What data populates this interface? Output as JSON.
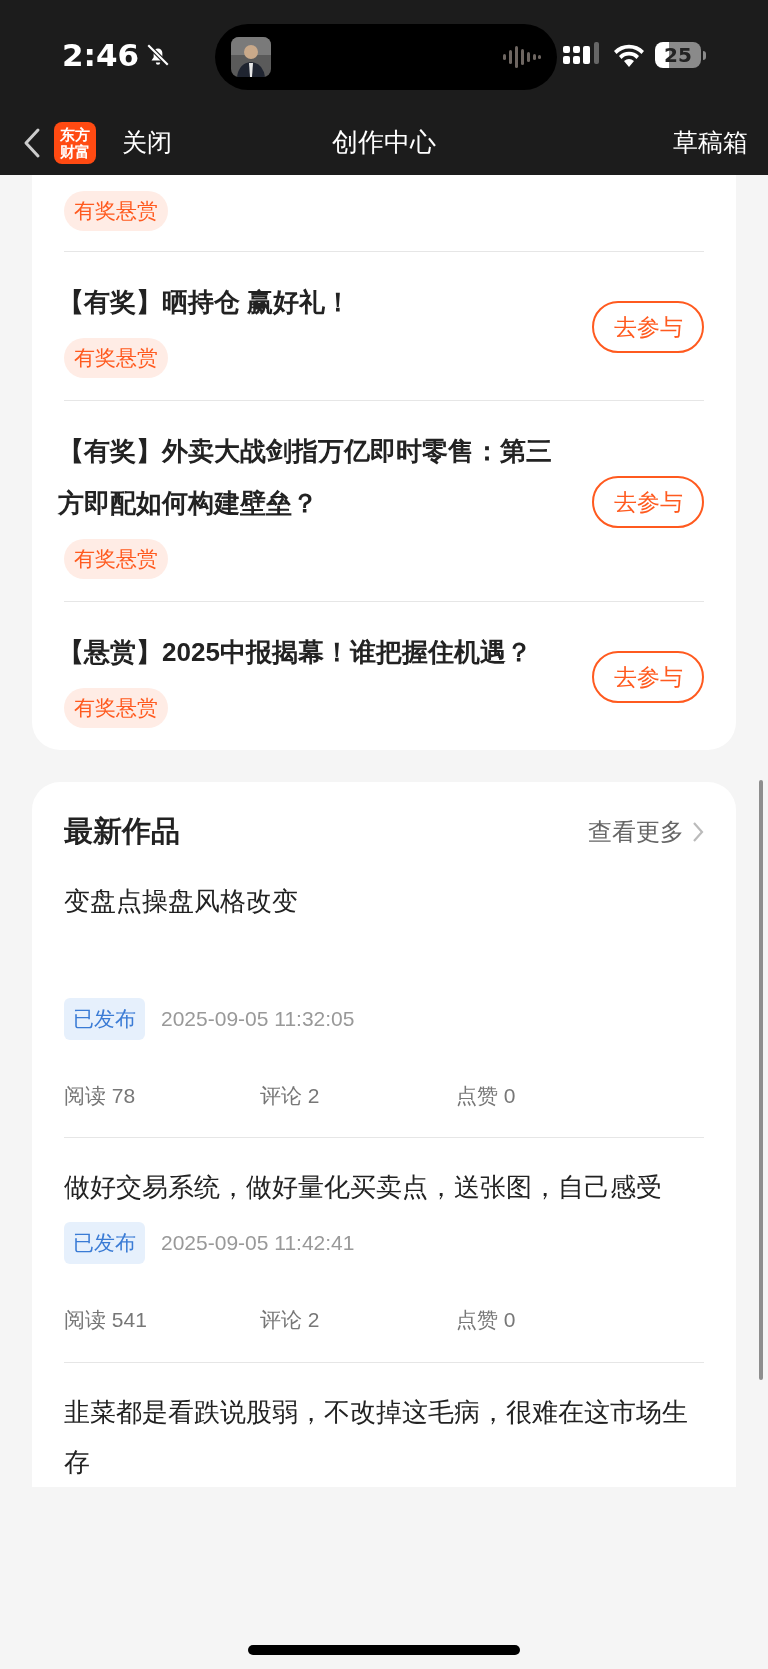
{
  "status_bar": {
    "time": "2:46",
    "battery": "25"
  },
  "nav": {
    "logo": [
      "东方",
      "财富"
    ],
    "close": "关闭",
    "title": "创作中心",
    "drafts": "草稿箱"
  },
  "rewards": [
    {
      "tag": "有奖悬赏"
    },
    {
      "title": "【有奖】晒持仓 赢好礼！",
      "tag": "有奖悬赏",
      "button": "去参与"
    },
    {
      "title": "【有奖】外卖大战剑指万亿即时零售：第三方即配如何构建壁垒？",
      "tag": "有奖悬赏",
      "button": "去参与"
    },
    {
      "title": "【悬赏】2025中报揭幕！谁把握住机遇？",
      "tag": "有奖悬赏",
      "button": "去参与"
    }
  ],
  "latest": {
    "title": "最新作品",
    "more": "查看更多",
    "posts": [
      {
        "title": "变盘点操盘风格改变",
        "status": "已发布",
        "date": "2025-09-05 11:32:05",
        "stats": [
          "阅读 78",
          "评论 2",
          "点赞 0"
        ]
      },
      {
        "title": "做好交易系统，做好量化买卖点，送张图，自己感受",
        "status": "已发布",
        "date": "2025-09-05 11:42:41",
        "stats": [
          "阅读 541",
          "评论 2",
          "点赞 0"
        ]
      },
      {
        "title": "韭菜都是看跌说股弱，不改掉这毛病，很难在这市场生存"
      }
    ]
  }
}
